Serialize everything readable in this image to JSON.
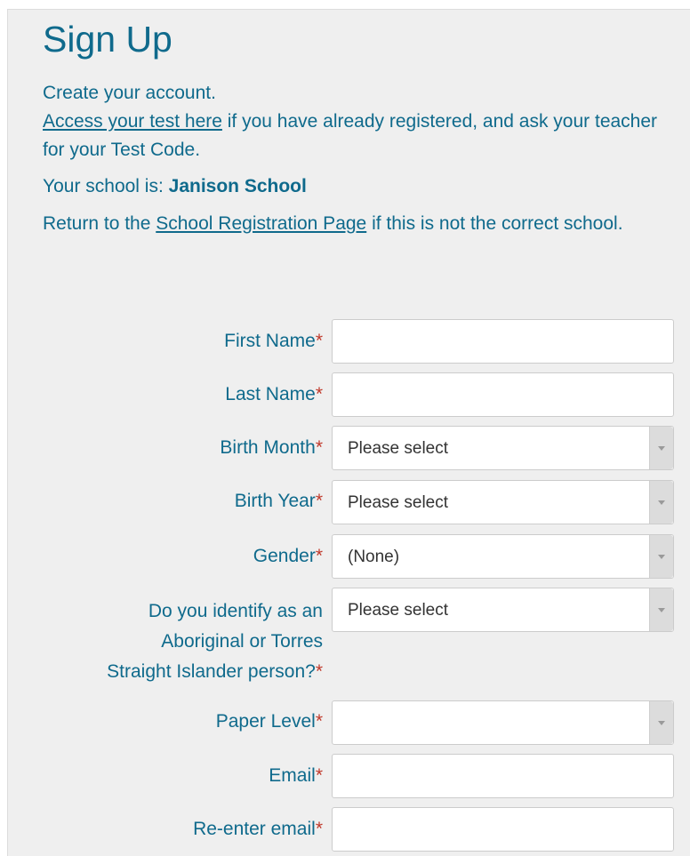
{
  "page": {
    "title": "Sign Up",
    "intro_line1": "Create your account.",
    "access_link": "Access your test here",
    "access_rest": " if you have already registered, and ask your teacher for your Test Code.",
    "school_prefix": "Your school is: ",
    "school_name": "Janison School",
    "return_prefix": "Return to the ",
    "return_link": "School Registration Page",
    "return_suffix": " if this is not the correct school."
  },
  "required_mark": "*",
  "form": {
    "first_name": {
      "label": "First Name",
      "value": ""
    },
    "last_name": {
      "label": "Last Name",
      "value": ""
    },
    "birth_month": {
      "label": "Birth Month",
      "selected": "Please select"
    },
    "birth_year": {
      "label": "Birth Year",
      "selected": "Please select"
    },
    "gender": {
      "label": "Gender",
      "selected": "(None)"
    },
    "indigenous": {
      "label_line1": "Do you identify as an",
      "label_line2": "Aboriginal or Torres",
      "label_line3": "Straight Islander person?",
      "selected": "Please select"
    },
    "paper_level": {
      "label": "Paper Level",
      "selected": ""
    },
    "email": {
      "label": "Email",
      "value": ""
    },
    "reenter_email": {
      "label": "Re-enter email",
      "value": ""
    }
  },
  "colors": {
    "primary_text": "#0f6a8c",
    "required": "#c0392b",
    "panel_bg": "#efefef"
  }
}
